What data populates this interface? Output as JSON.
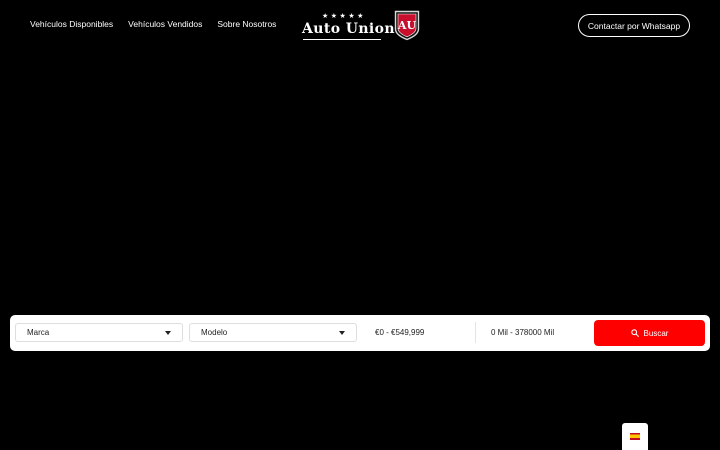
{
  "nav": {
    "items": [
      {
        "label": "Vehículos Disponibles"
      },
      {
        "label": "Vehículos Vendidos"
      },
      {
        "label": "Sobre Nosotros"
      }
    ]
  },
  "logo": {
    "stars": "★★★★★",
    "name": "Auto Union",
    "badge_text": "AU"
  },
  "header": {
    "whatsapp_label": "Contactar por Whatsapp"
  },
  "search": {
    "make_label": "Marca",
    "model_label": "Modelo",
    "price_range": "€0 - €549,999",
    "mileage_range": "0 Mil - 378000 Mil",
    "button_label": "Buscar"
  },
  "colors": {
    "background": "#000000",
    "accent": "#ff0000",
    "search_bar": "#ffffff"
  },
  "language": {
    "flag_icon": "spain-flag-icon"
  }
}
